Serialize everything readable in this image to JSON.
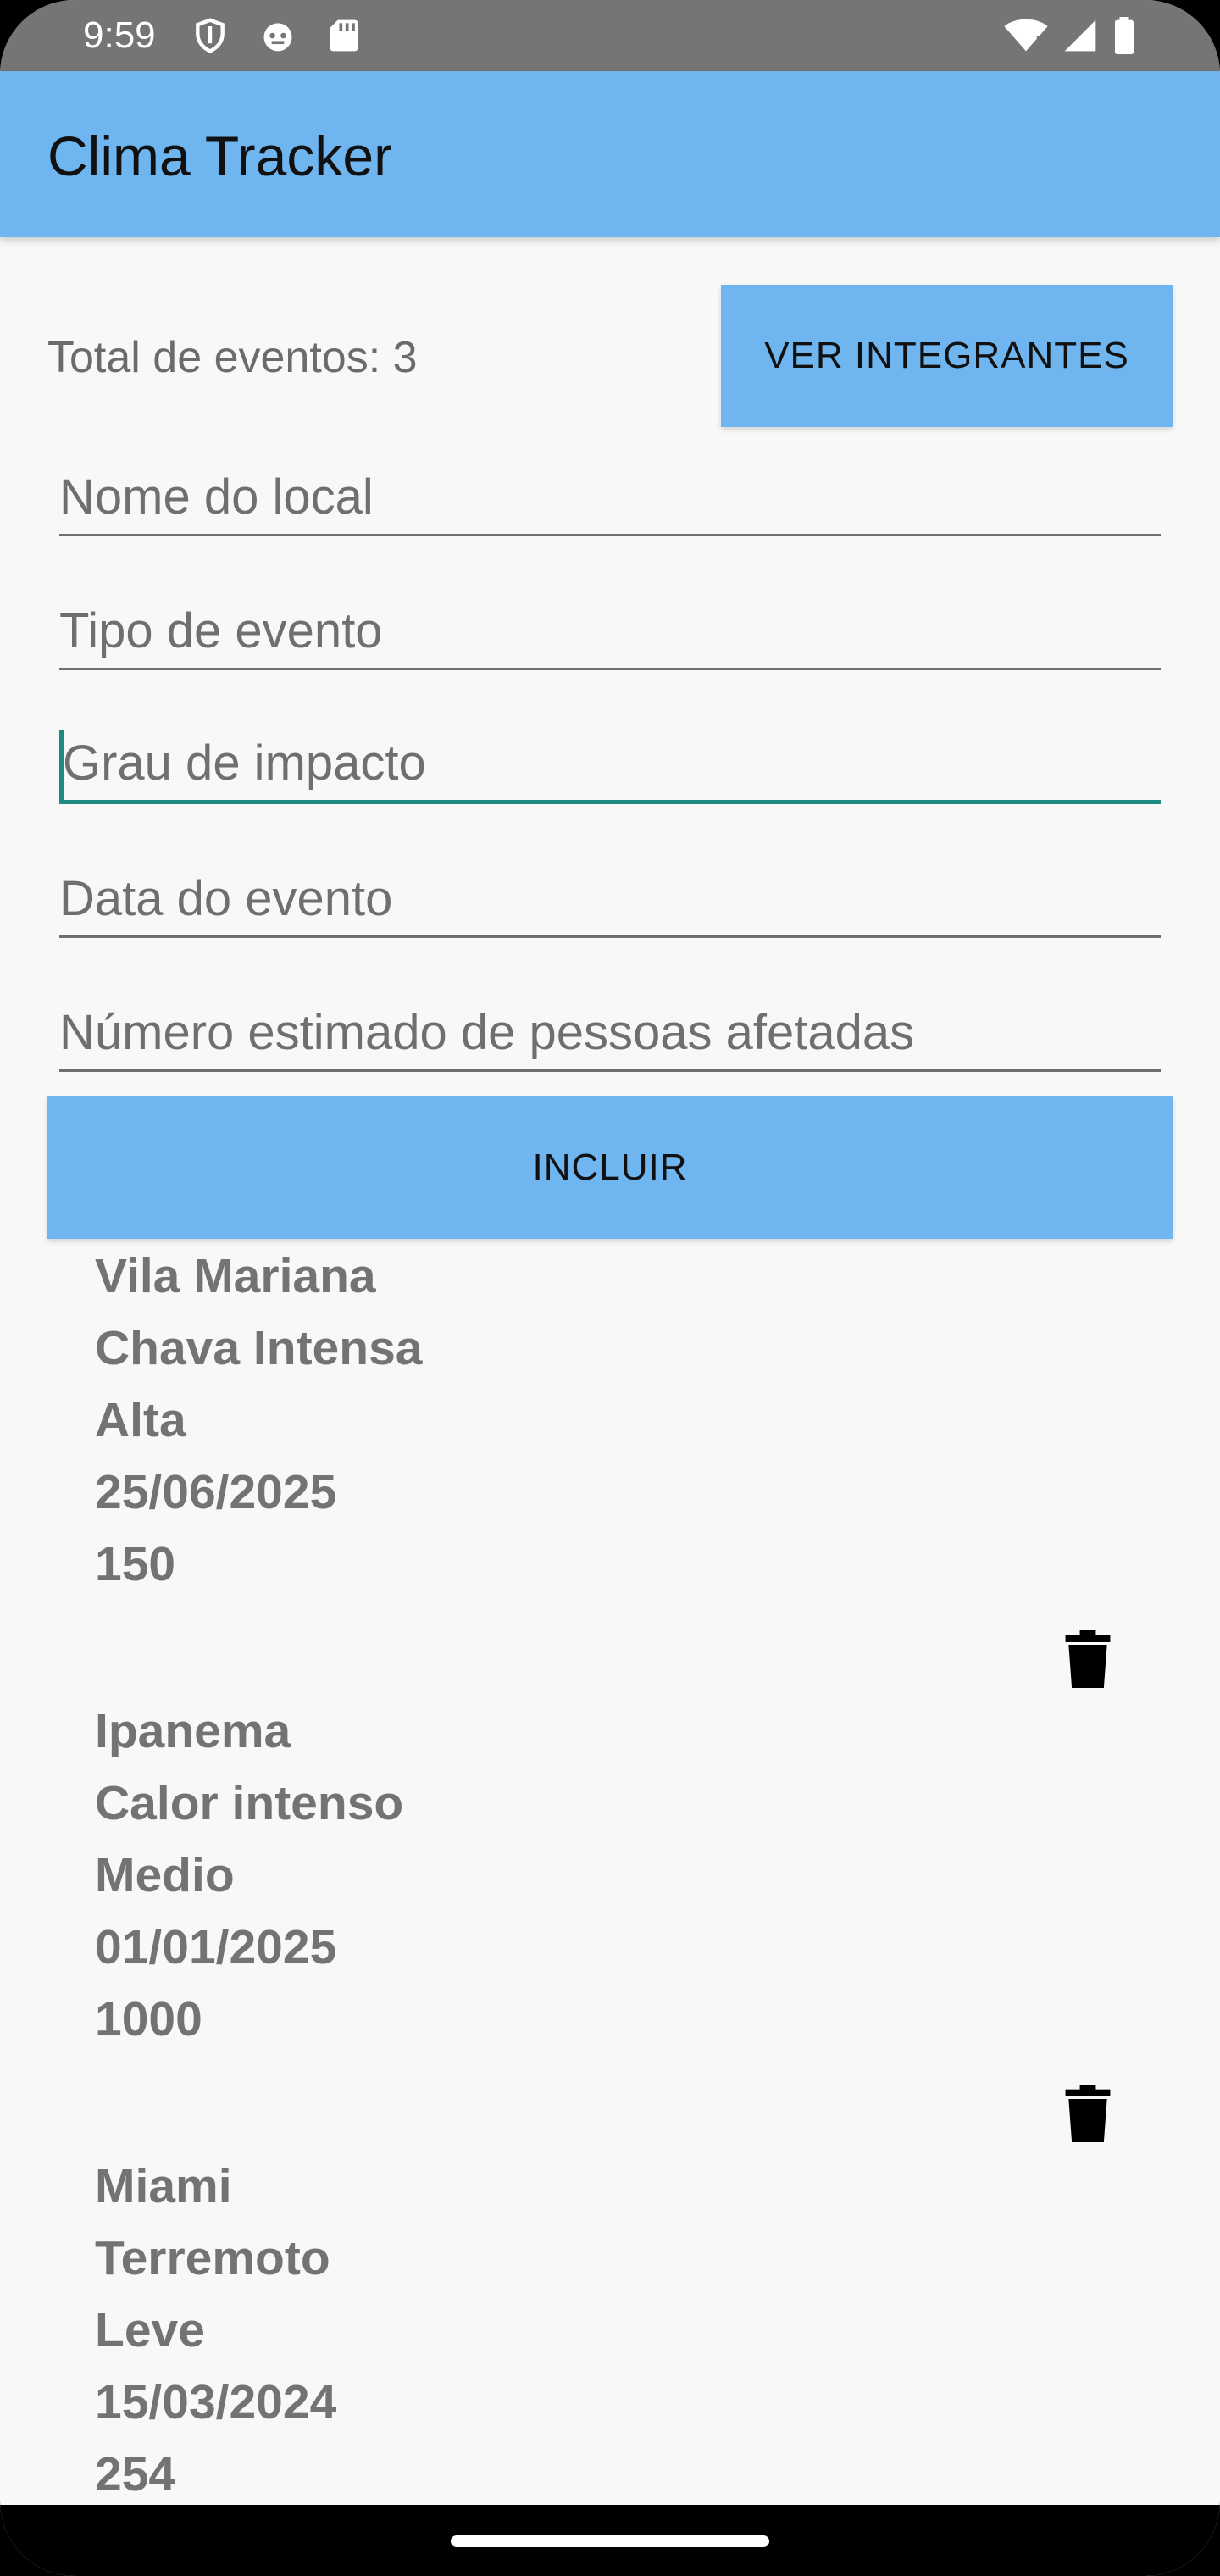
{
  "status_bar": {
    "time": "9:59",
    "icons_left": [
      "shield-icon",
      "cat-face-icon",
      "sd-card-icon"
    ],
    "icons_right": [
      "wifi-icon",
      "signal-icon",
      "battery-icon"
    ]
  },
  "app_bar": {
    "title": "Clima Tracker",
    "color": "#6fb6f1"
  },
  "summary": {
    "total_label": "Total de eventos: 3"
  },
  "buttons": {
    "members_label": "VER INTEGRANTES",
    "include_label": "INCLUIR"
  },
  "form": {
    "fields": [
      {
        "placeholder": "Nome do local",
        "value": ""
      },
      {
        "placeholder": "Tipo de evento",
        "value": ""
      },
      {
        "placeholder": "Grau de impacto",
        "value": ""
      },
      {
        "placeholder": "Data do evento",
        "value": ""
      },
      {
        "placeholder": "Número estimado de pessoas afetadas",
        "value": ""
      }
    ],
    "accent_color": "#1e8a80"
  },
  "events": [
    {
      "local": "Vila Mariana",
      "tipo": "Chava Intensa",
      "grau": "Alta",
      "data": "25/06/2025",
      "pessoas": "150",
      "delete_icon": "trash-icon"
    },
    {
      "local": "Ipanema",
      "tipo": "Calor intenso",
      "grau": "Medio",
      "data": "01/01/2025",
      "pessoas": "1000",
      "delete_icon": "trash-icon"
    },
    {
      "local": "Miami",
      "tipo": "Terremoto",
      "grau": "Leve",
      "data": "15/03/2024",
      "pessoas": "254"
    }
  ]
}
